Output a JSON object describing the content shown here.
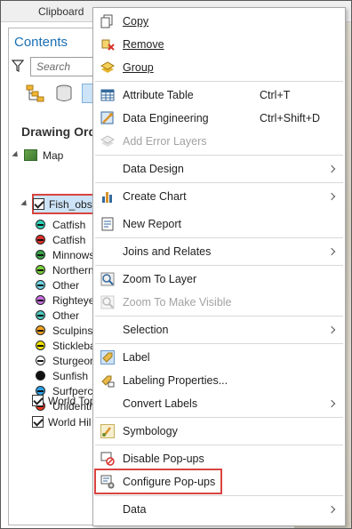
{
  "ribbon": {
    "group_label": "Clipboard"
  },
  "contents": {
    "title": "Contents",
    "search_placeholder": "Search",
    "drawing_order": "Drawing Ord",
    "map_label": "Map",
    "layer_label": "Fish_obse",
    "symbols": [
      {
        "label": "Catfish",
        "color": "#2fd3b8"
      },
      {
        "label": "Catfish",
        "color": "#e0302a"
      },
      {
        "label": "Minnows",
        "color": "#3aa64a"
      },
      {
        "label": "Northern",
        "color": "#7ad23a"
      },
      {
        "label": "Other",
        "color": "#6fd6e6"
      },
      {
        "label": "Righteye",
        "color": "#c56ee0"
      },
      {
        "label": "Other",
        "color": "#4dc8c0"
      },
      {
        "label": "Sculpins",
        "color": "#f0a020"
      },
      {
        "label": "Sticklebac",
        "color": "#f2e200"
      },
      {
        "label": "Sturgeon",
        "color": "#ffffff"
      },
      {
        "label": "Sunfish",
        "color": "#111111"
      },
      {
        "label": "Surfperch",
        "color": "#2aa0e6"
      },
      {
        "label": "Unidentif",
        "color": "#ff3a1c"
      }
    ],
    "basemaps": [
      "World Top",
      "World Hil"
    ]
  },
  "menu": {
    "copy": "Copy",
    "remove": "Remove",
    "group": "Group",
    "attribute_table": "Attribute Table",
    "attribute_table_sc": "Ctrl+T",
    "data_engineering": "Data Engineering",
    "data_engineering_sc": "Ctrl+Shift+D",
    "add_error_layers": "Add Error Layers",
    "data_design": "Data Design",
    "create_chart": "Create Chart",
    "new_report": "New Report",
    "joins_relates": "Joins and Relates",
    "zoom_to_layer": "Zoom To Layer",
    "zoom_visible": "Zoom To Make Visible",
    "selection": "Selection",
    "label": "Label",
    "labeling_props": "Labeling Properties...",
    "convert_labels": "Convert Labels",
    "symbology": "Symbology",
    "disable_popups": "Disable Pop-ups",
    "configure_popups": "Configure Pop-ups",
    "data": "Data"
  }
}
